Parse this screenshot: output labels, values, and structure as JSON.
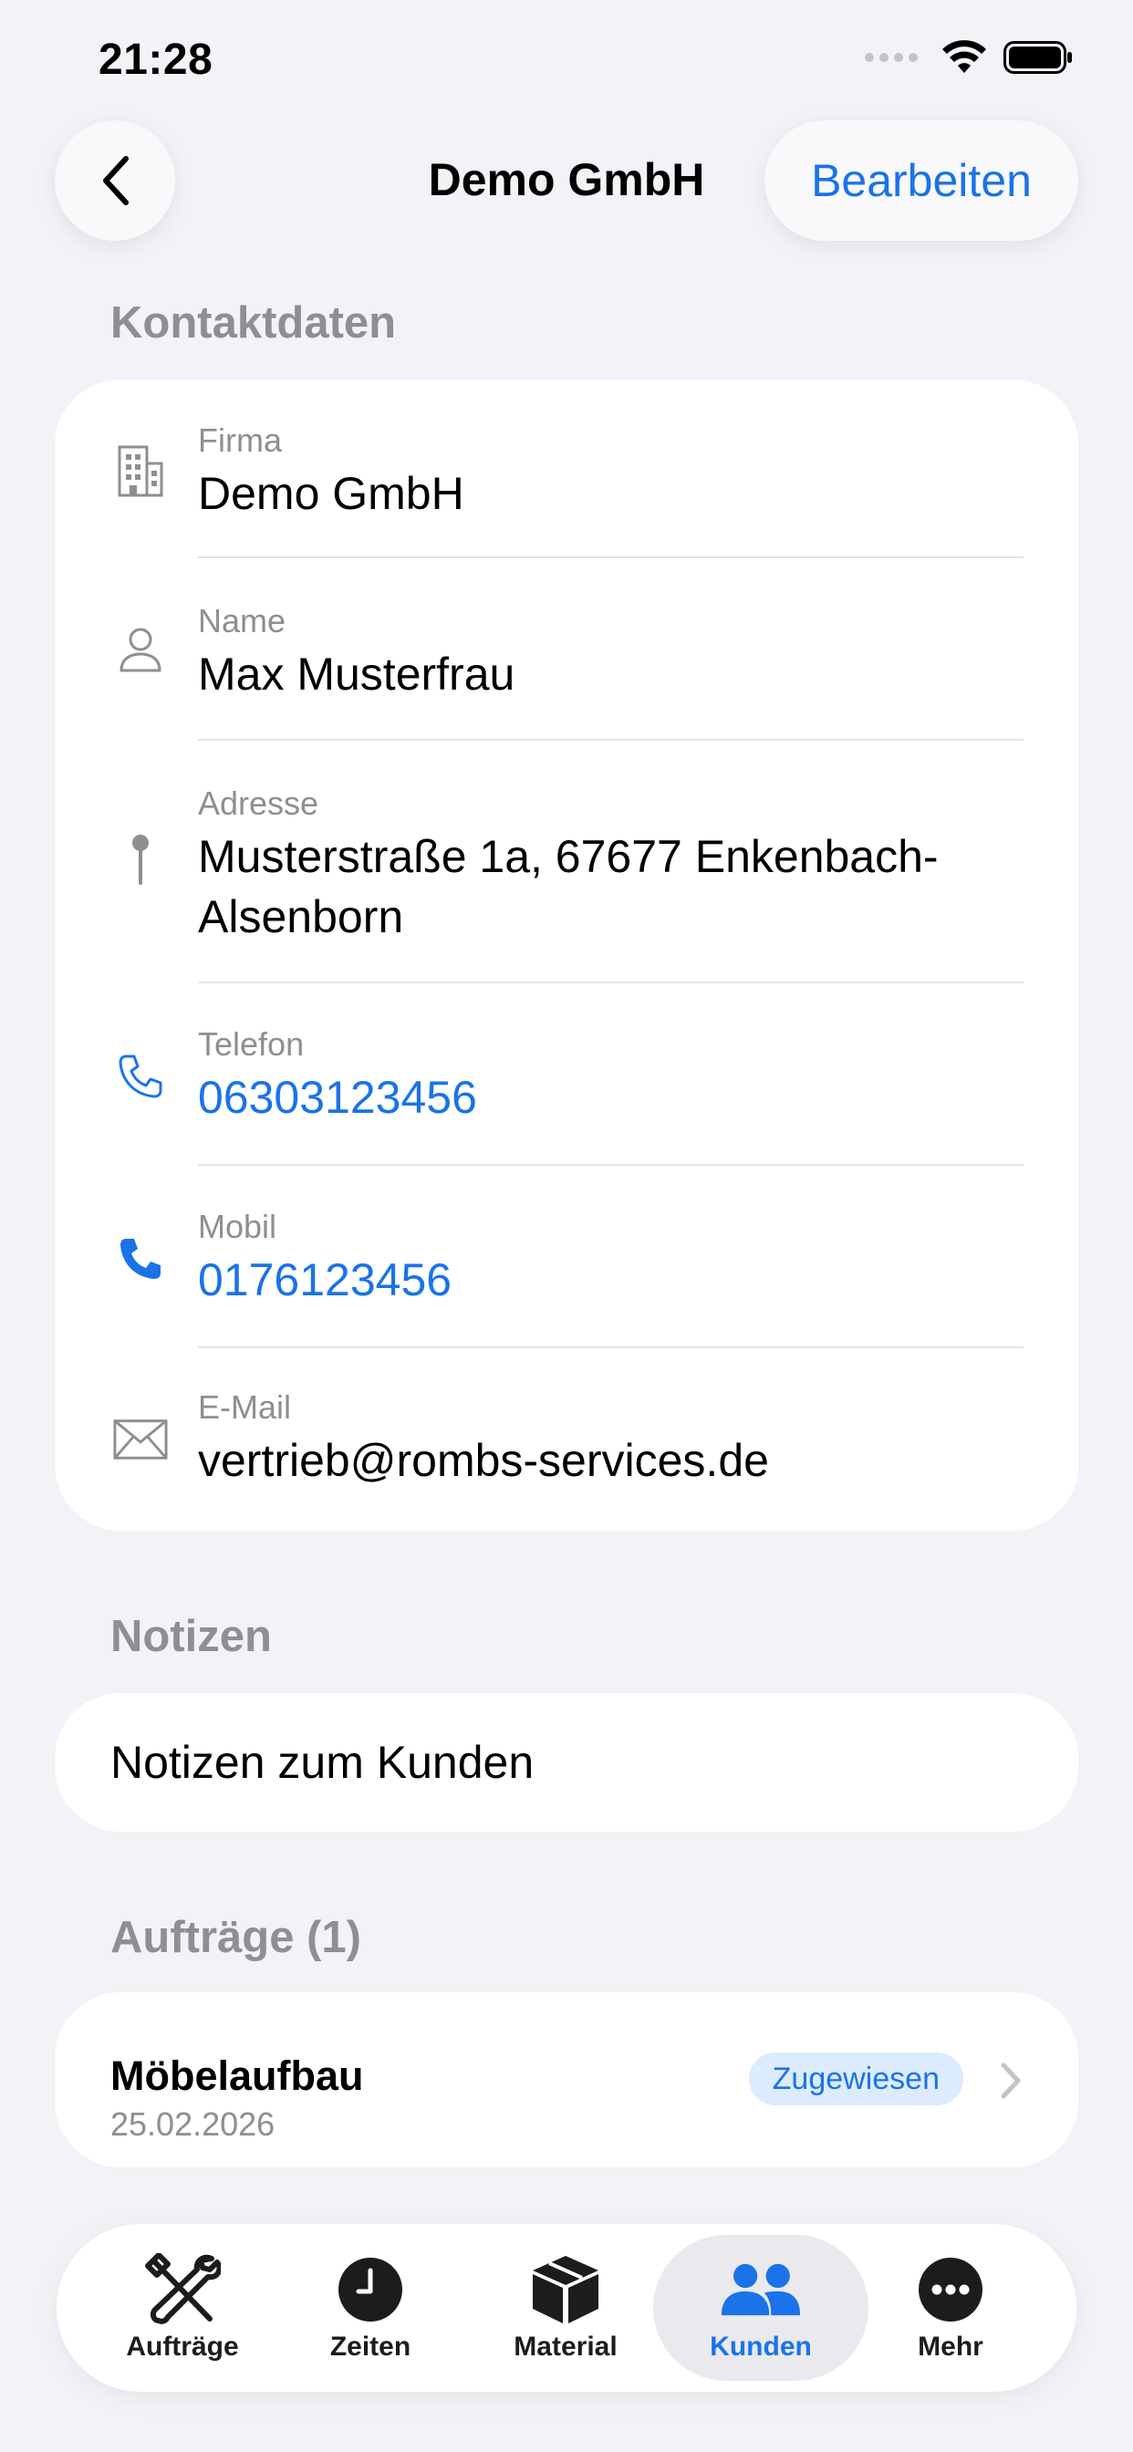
{
  "status_bar": {
    "time": "21:28"
  },
  "nav": {
    "title": "Demo GmbH",
    "edit_label": "Bearbeiten"
  },
  "sections": {
    "contact_header": "Kontaktdaten",
    "notes_header": "Notizen",
    "orders_header": "Aufträge (1)"
  },
  "contact": {
    "company": {
      "label": "Firma",
      "value": "Demo GmbH"
    },
    "name": {
      "label": "Name",
      "value": "Max Musterfrau"
    },
    "address": {
      "label": "Adresse",
      "value": "Musterstraße 1a, 67677 Enkenbach-Alsenborn"
    },
    "phone": {
      "label": "Telefon",
      "value": "06303123456"
    },
    "mobile": {
      "label": "Mobil",
      "value": "0176123456"
    },
    "email": {
      "label": "E-Mail",
      "value": "vertrieb@rombs-services.de"
    }
  },
  "notes": {
    "placeholder": "Notizen zum Kunden"
  },
  "orders": [
    {
      "title": "Möbelaufbau",
      "date": "25.02.2026",
      "status": "Zugewiesen"
    }
  ],
  "tabs": [
    {
      "label": "Aufträge",
      "icon": "tools-icon"
    },
    {
      "label": "Zeiten",
      "icon": "clock-icon"
    },
    {
      "label": "Material",
      "icon": "box-icon"
    },
    {
      "label": "Kunden",
      "icon": "people-icon",
      "active": true
    },
    {
      "label": "Mehr",
      "icon": "more-icon"
    }
  ],
  "colors": {
    "accent": "#1A73E8",
    "background": "#F2F2F7",
    "badge_bg": "#DCEBFD"
  }
}
